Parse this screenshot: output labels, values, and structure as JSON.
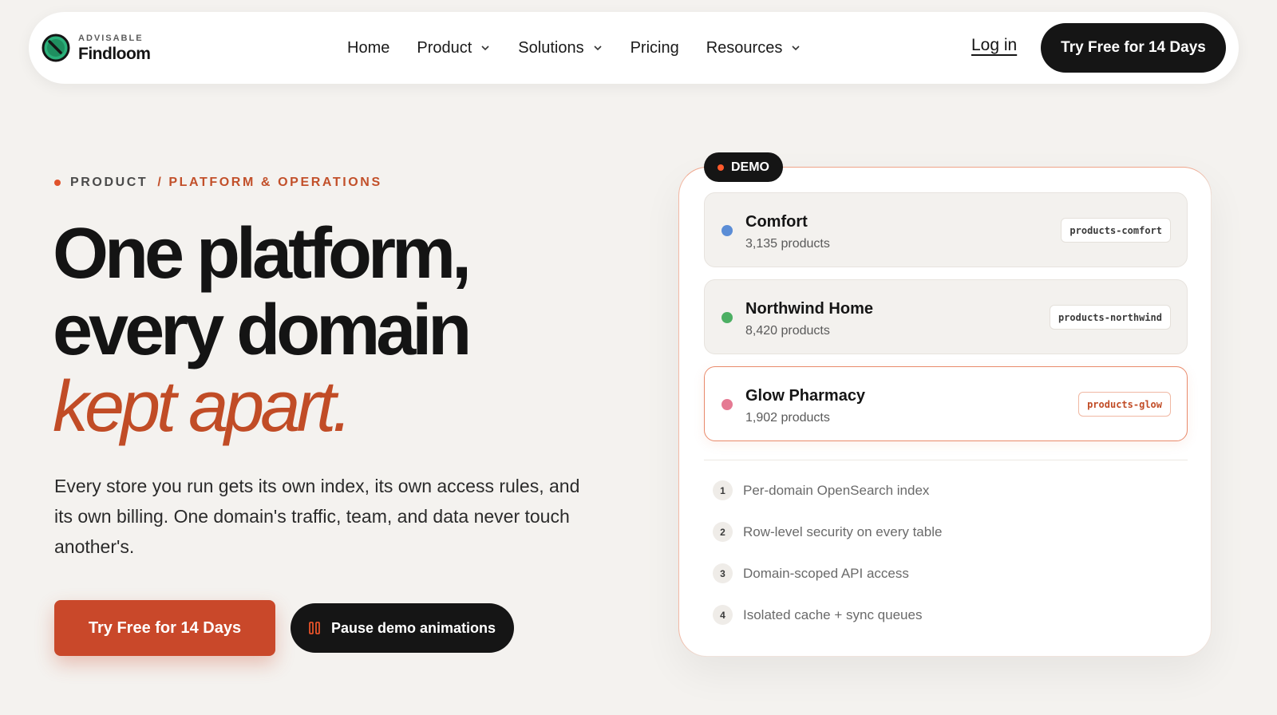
{
  "nav": {
    "brand_small": "ADVISABLE",
    "brand_name": "Findloom",
    "links": [
      {
        "label": "Home",
        "dropdown": false
      },
      {
        "label": "Product",
        "dropdown": true
      },
      {
        "label": "Solutions",
        "dropdown": true
      },
      {
        "label": "Pricing",
        "dropdown": false
      },
      {
        "label": "Resources",
        "dropdown": true
      }
    ],
    "login_label": "Log in",
    "cta_label": "Try Free for 14 Days"
  },
  "hero": {
    "eyebrow_primary": "PRODUCT",
    "eyebrow_secondary": "/ PLATFORM & OPERATIONS",
    "headline_line1": "One platform,",
    "headline_line2": "every domain",
    "headline_accent": "kept apart.",
    "lede": "Every store you run gets its own index, its own access rules, and its own billing. One domain's traffic, team, and data never touch another's.",
    "cta_primary": "Try Free for 14 Days",
    "cta_secondary": "Pause demo animations"
  },
  "demo": {
    "badge": "DEMO",
    "domains": [
      {
        "name": "Comfort",
        "count": "3,135 products",
        "index": "products-comfort",
        "color": "#5b8dd6",
        "active": false
      },
      {
        "name": "Northwind Home",
        "count": "8,420 products",
        "index": "products-northwind",
        "color": "#4caf63",
        "active": false
      },
      {
        "name": "Glow Pharmacy",
        "count": "1,902 products",
        "index": "products-glow",
        "color": "#e57a93",
        "active": true
      }
    ],
    "features": [
      {
        "num": "1",
        "label": "Per-domain OpenSearch index"
      },
      {
        "num": "2",
        "label": "Row-level security on every table"
      },
      {
        "num": "3",
        "label": "Domain-scoped API access"
      },
      {
        "num": "4",
        "label": "Isolated cache + sync queues"
      }
    ]
  },
  "colors": {
    "accent": "#c9482a",
    "dark": "#151515",
    "background": "#f4f2ef"
  }
}
